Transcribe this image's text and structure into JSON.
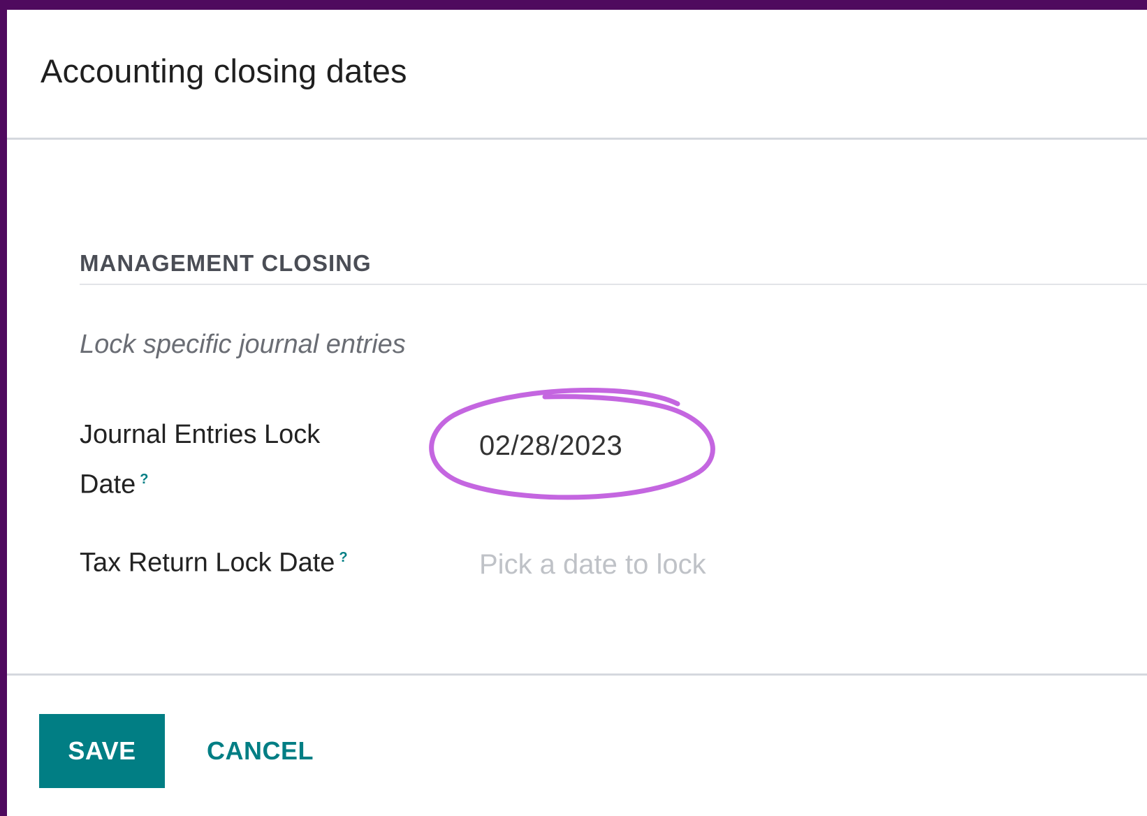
{
  "dialog": {
    "title": "Accounting closing dates"
  },
  "section": {
    "title": "MANAGEMENT CLOSING",
    "description": "Lock specific journal entries"
  },
  "fields": {
    "journal_lock": {
      "label": "Journal Entries Lock Date",
      "help": "?",
      "value": "02/28/2023"
    },
    "tax_lock": {
      "label": "Tax Return Lock Date",
      "help": "?",
      "placeholder": "Pick a date to lock",
      "value": ""
    }
  },
  "footer": {
    "save_label": "SAVE",
    "cancel_label": "CANCEL"
  },
  "colors": {
    "primary": "#017e84",
    "backdrop": "#4f0a5e",
    "annotation": "#c466e0"
  },
  "icons": {
    "help": "help-icon",
    "annotation": "highlight-circle-annotation"
  }
}
